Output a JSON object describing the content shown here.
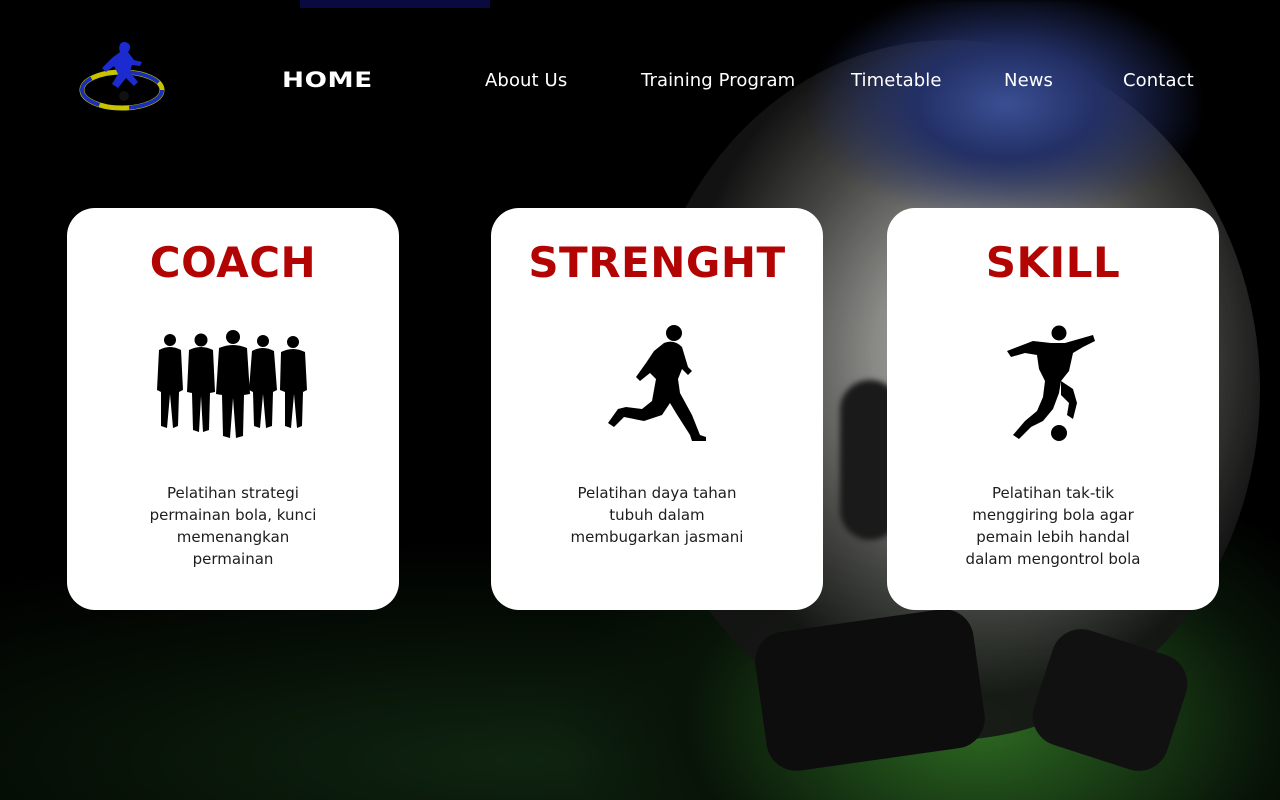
{
  "nav": {
    "home": "HOME",
    "items": [
      "About Us",
      "Training Program",
      "Timetable",
      "News",
      "Contact"
    ]
  },
  "cards": [
    {
      "title": "COACH",
      "icon": "team-silhouette-icon",
      "description": "Pelatihan strategi permainan bola, kunci memenangkan permainan"
    },
    {
      "title": "STRENGHT",
      "icon": "running-player-icon",
      "description": "Pelatihan daya tahan tubuh dalam membugarkan jasmani"
    },
    {
      "title": "SKILL",
      "icon": "dribbling-player-icon",
      "description": "Pelatihan tak-tik menggiring bola agar pemain lebih handal dalam mengontrol bola"
    }
  ],
  "colors": {
    "title": "#b30404",
    "card_bg": "#ffffff",
    "page_bg": "#000000"
  }
}
